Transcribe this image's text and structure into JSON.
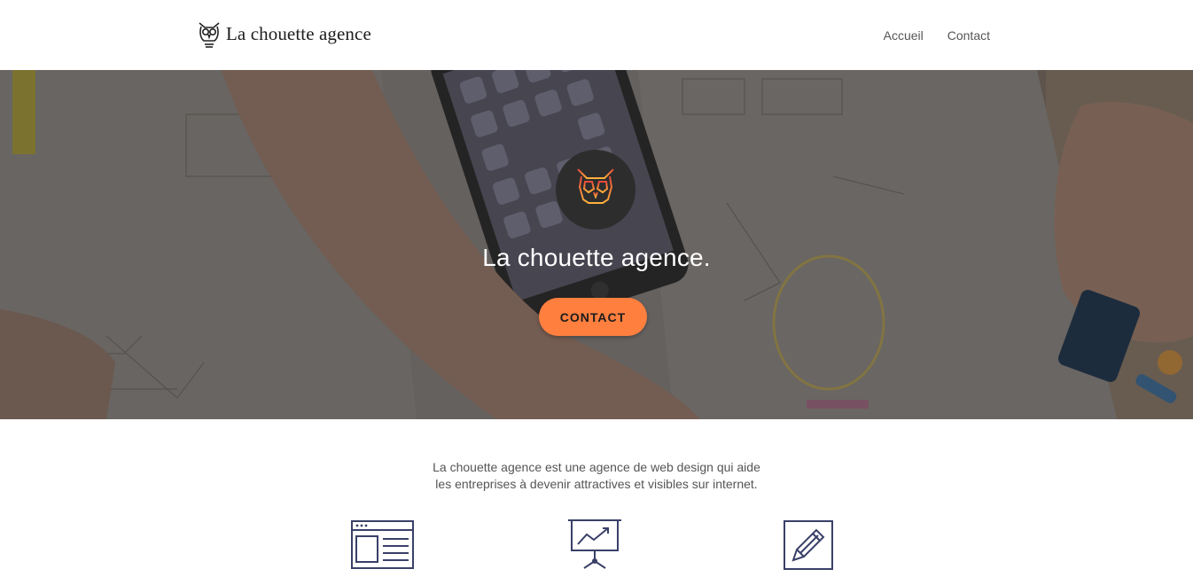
{
  "header": {
    "logo_text": "La chouette agence",
    "logo_icon": "owl-icon",
    "nav": [
      {
        "label": "Accueil"
      },
      {
        "label": "Contact"
      }
    ]
  },
  "hero": {
    "badge_icon": "owl-icon",
    "title": "La chouette agence.",
    "cta_label": "CONTACT",
    "background": "desk-with-phone-and-sketches-photo"
  },
  "intro": {
    "line1": "La chouette agence est une agence de web design qui aide",
    "line2": "les entreprises à devenir attractives et visibles sur internet."
  },
  "features": [
    {
      "icon": "browser-window-icon"
    },
    {
      "icon": "presentation-chart-icon"
    },
    {
      "icon": "pencil-edit-icon"
    }
  ],
  "colors": {
    "accent": "#ff7f3f",
    "icon_stroke": "#3a4068",
    "badge_bg": "#2d2d2d"
  }
}
